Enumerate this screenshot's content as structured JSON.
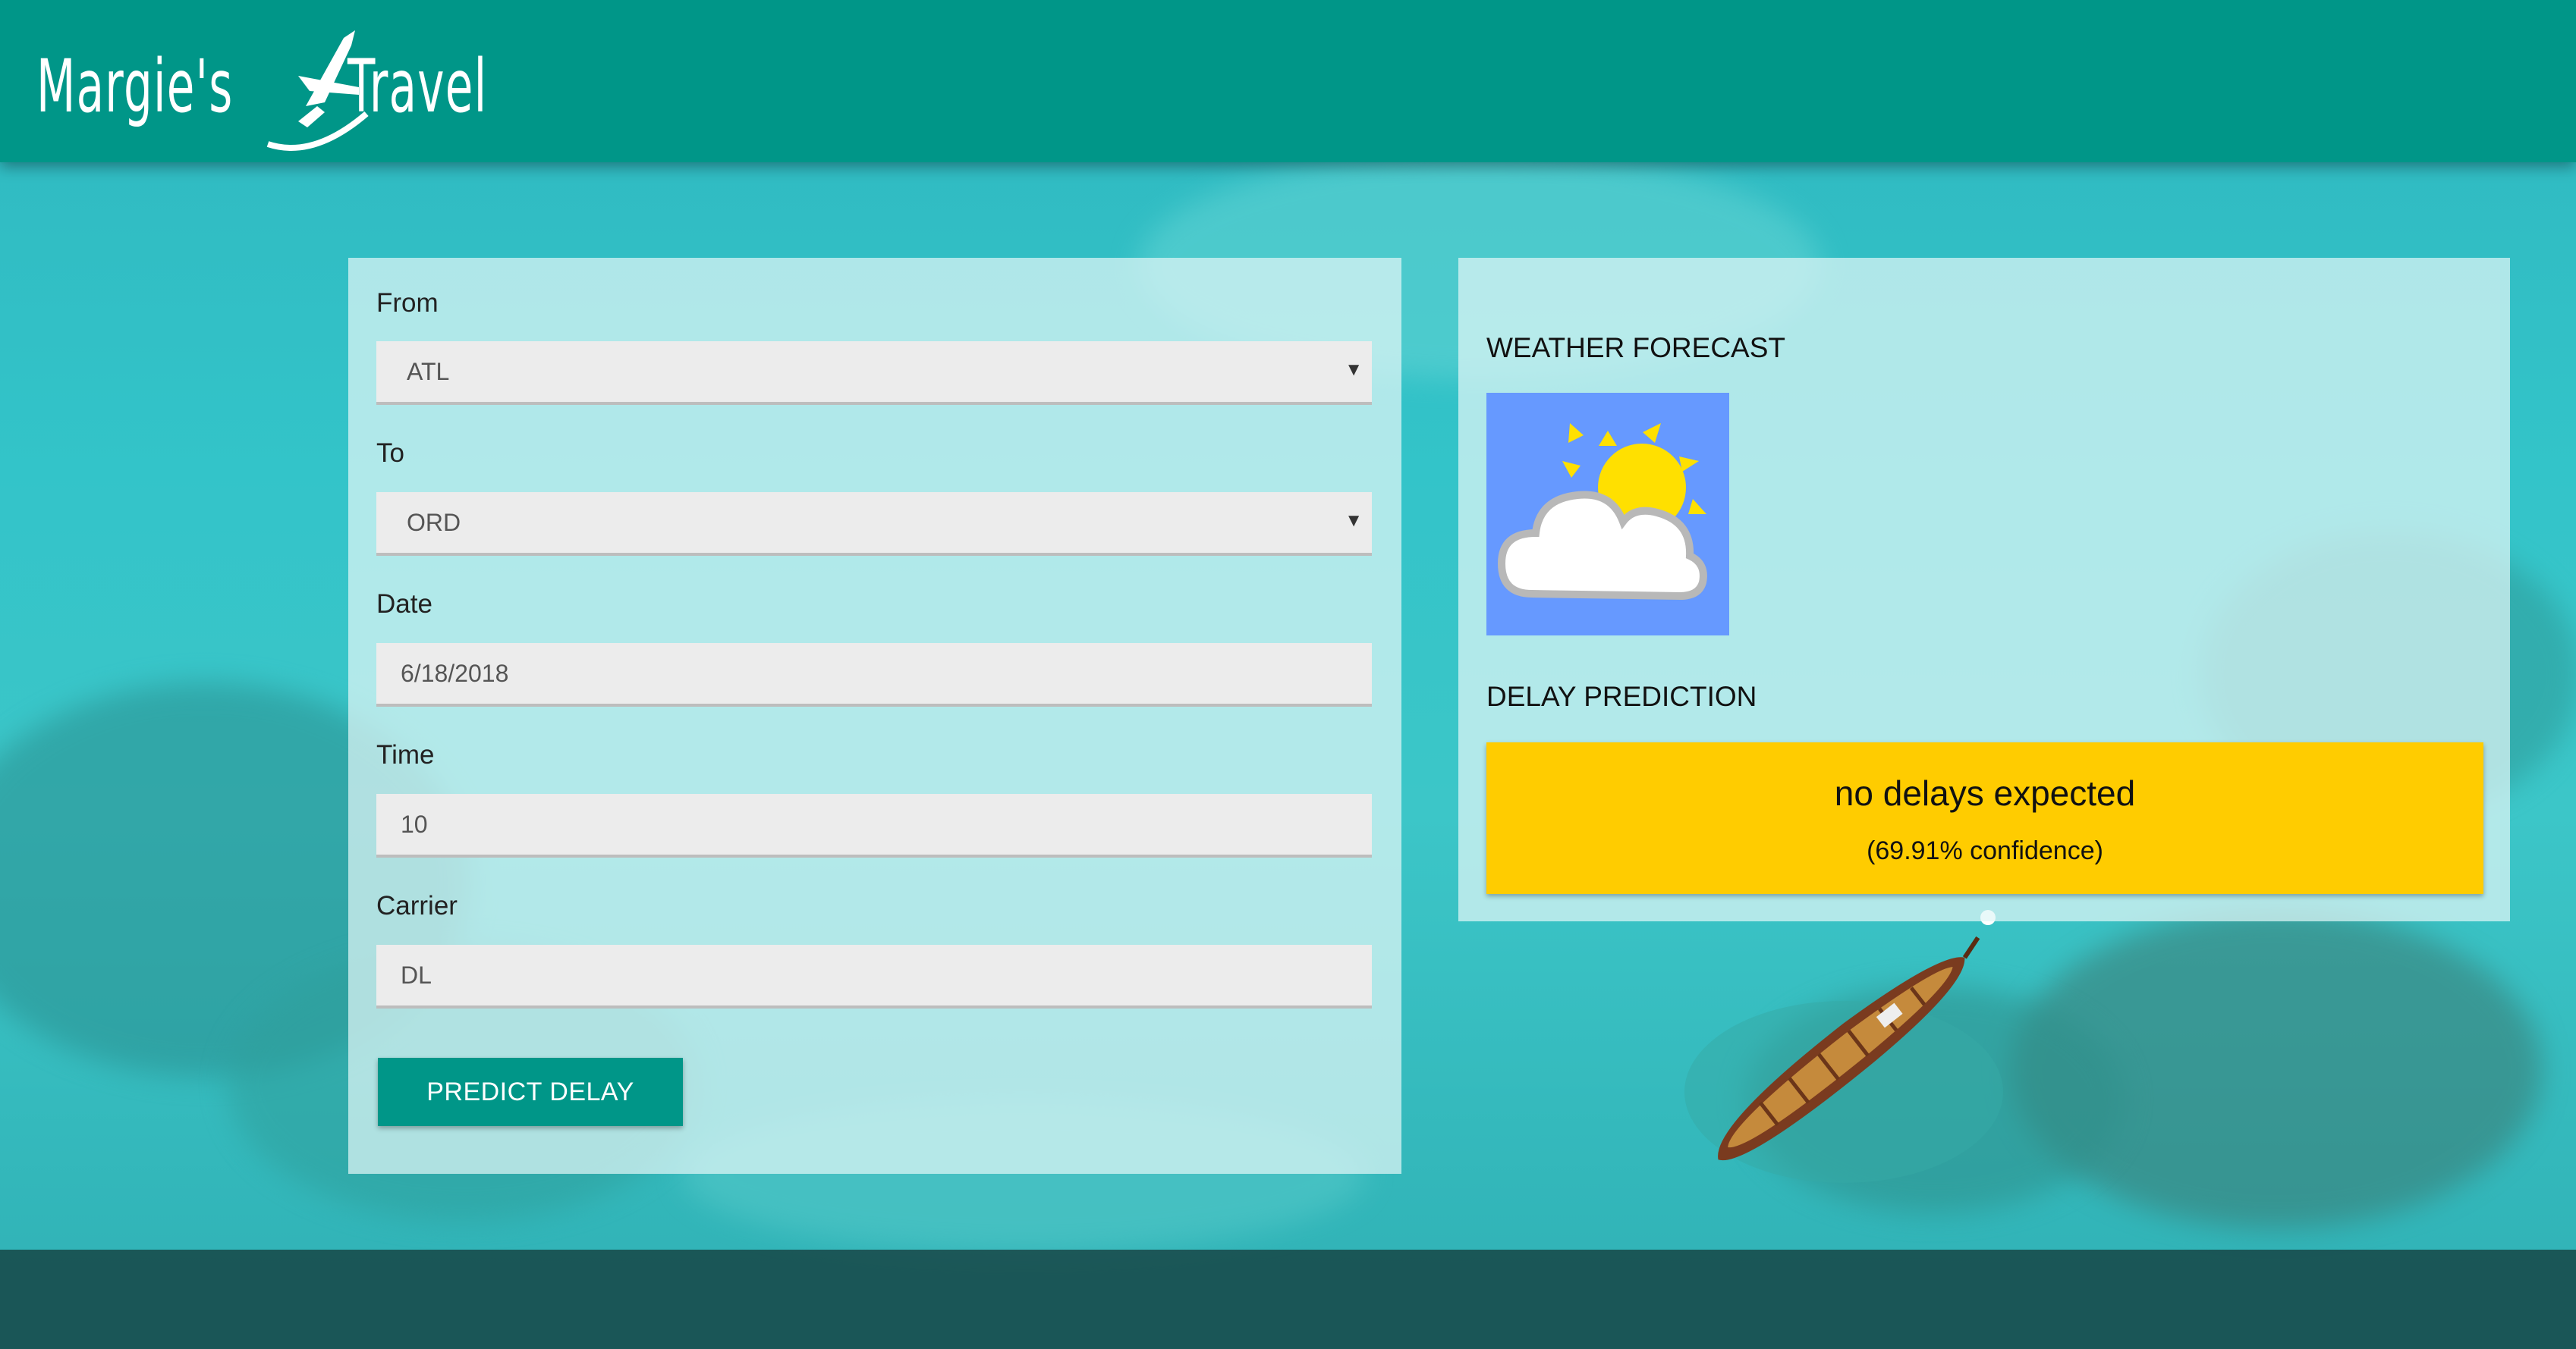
{
  "header": {
    "logo_left": "Margie's",
    "logo_right": "Travel"
  },
  "form": {
    "from": {
      "label": "From",
      "value": "ATL"
    },
    "to": {
      "label": "To",
      "value": "ORD"
    },
    "date": {
      "label": "Date",
      "value": "6/18/2018"
    },
    "time": {
      "label": "Time",
      "value": "10"
    },
    "carrier": {
      "label": "Carrier",
      "value": "DL"
    },
    "submit_label": "PREDICT DELAY"
  },
  "results": {
    "weather_title": "WEATHER FORECAST",
    "weather_icon": "partly-cloudy-icon",
    "delay_title": "DELAY PREDICTION",
    "delay_text": "no delays expected",
    "confidence_text": "(69.91% confidence)"
  },
  "colors": {
    "header": "#009688",
    "button": "#009688",
    "delay_box": "#ffcc00",
    "weather_bg": "#6699ff"
  }
}
